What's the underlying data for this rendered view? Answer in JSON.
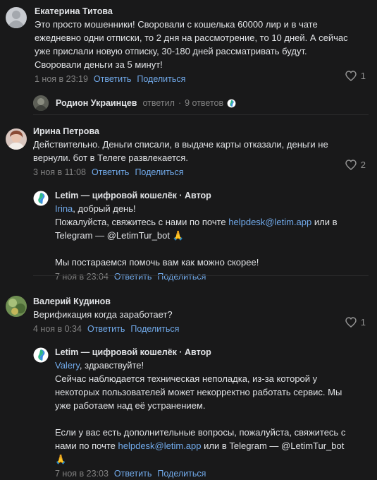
{
  "comments": [
    {
      "author": "Екатерина Титова",
      "text": "Это просто мошенники! Своровали с кошелька 60000 лир и в чате ежедневно одни отписки, то 2 дня на рассмотрение, то 10 дней. А сейчас уже прислали новую отписку, 30-180 дней рассматривать будут. Своровали деньги за 5 минут!",
      "date": "1 ноя в 23:19",
      "reply_label": "Ответить",
      "share_label": "Поделиться",
      "likes": "1",
      "replies_summary": {
        "author": "Родион Украинцев",
        "action": "ответил",
        "separator": "·",
        "count": "9 ответов"
      }
    },
    {
      "author": "Ирина Петрова",
      "text": "Действительно. Деньги списали, в выдаче карты отказали, деньги не вернули. бот в Телеге развлекается.",
      "date": "3 ноя в 11:08",
      "reply_label": "Ответить",
      "share_label": "Поделиться",
      "likes": "2",
      "reply": {
        "author": "Letim — цифровой кошелёк · Автор",
        "addressee": "Irina",
        "greeting": ", добрый день!",
        "line1_pre": "Пожалуйста, свяжитесь с нами по почте ",
        "email": "helpdesk@letim.app",
        "line1_post": " или в Telegram — @LetimTur_bot 🙏",
        "line2": "Мы постараемся помочь вам как можно скорее!",
        "date": "7 ноя в 23:04",
        "reply_label": "Ответить",
        "share_label": "Поделиться"
      }
    },
    {
      "author": "Валерий Кудинов",
      "text": "Верификация когда заработает?",
      "date": "4 ноя в 0:34",
      "reply_label": "Ответить",
      "share_label": "Поделиться",
      "likes": "1",
      "reply": {
        "author": "Letim — цифровой кошелёк · Автор",
        "addressee": "Valery",
        "greeting": ", здравствуйте!",
        "para1": "Сейчас наблюдается техническая неполадка, из-за которой у некоторых пользователей может некорректно работать сервис. Мы уже работаем над её устранением.",
        "line2_pre": "Если у вас есть дополнительные вопросы, пожалуйста, свяжитесь с нами по почте ",
        "email": "helpdesk@letim.app",
        "line2_post": " или в Telegram — @LetimTur_bot 🙏",
        "date": "7 ноя в 23:03",
        "reply_label": "Ответить",
        "share_label": "Поделиться"
      }
    }
  ],
  "colors": {
    "background": "#19191a",
    "text": "#e1e3e6",
    "link": "#71aaeb",
    "muted": "#828282"
  }
}
